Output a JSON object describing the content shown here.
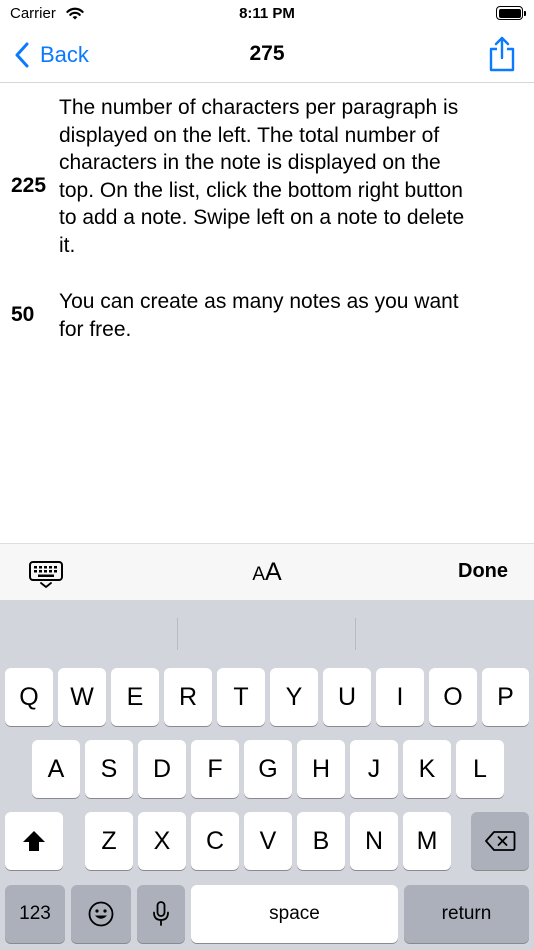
{
  "status_bar": {
    "carrier": "Carrier",
    "time": "8:11 PM",
    "icons": [
      "wifi-icon",
      "battery-icon"
    ]
  },
  "nav": {
    "back_label": "Back",
    "title": "275",
    "accent_color": "#0a7aff",
    "share_icon": "share-icon"
  },
  "paragraphs": [
    {
      "count": "225",
      "lines": [
        "The number of characters per paragraph is",
        "displayed on the left. The total number of",
        "characters in the note is displayed on the",
        "top. On the list, click the bottom right button",
        "to add a note. Swipe left on a note to delete",
        "it."
      ]
    },
    {
      "count": "50",
      "lines": [
        "You can create as many notes as you want",
        "for free."
      ]
    }
  ],
  "toolbar": {
    "keyboard_icon": "keyboard-dismiss-icon",
    "text_size_small": "A",
    "text_size_large": "A",
    "done_label": "Done"
  },
  "keyboard": {
    "row1": [
      "Q",
      "W",
      "E",
      "R",
      "T",
      "Y",
      "U",
      "I",
      "O",
      "P"
    ],
    "row2": [
      "A",
      "S",
      "D",
      "F",
      "G",
      "H",
      "J",
      "K",
      "L"
    ],
    "row3": [
      "Z",
      "X",
      "C",
      "V",
      "B",
      "N",
      "M"
    ],
    "shift_icon": "shift-icon",
    "delete_icon": "delete-icon",
    "numbers_label": "123",
    "emoji_icon": "emoji-icon",
    "mic_icon": "microphone-icon",
    "space_label": "space",
    "return_label": "return"
  }
}
